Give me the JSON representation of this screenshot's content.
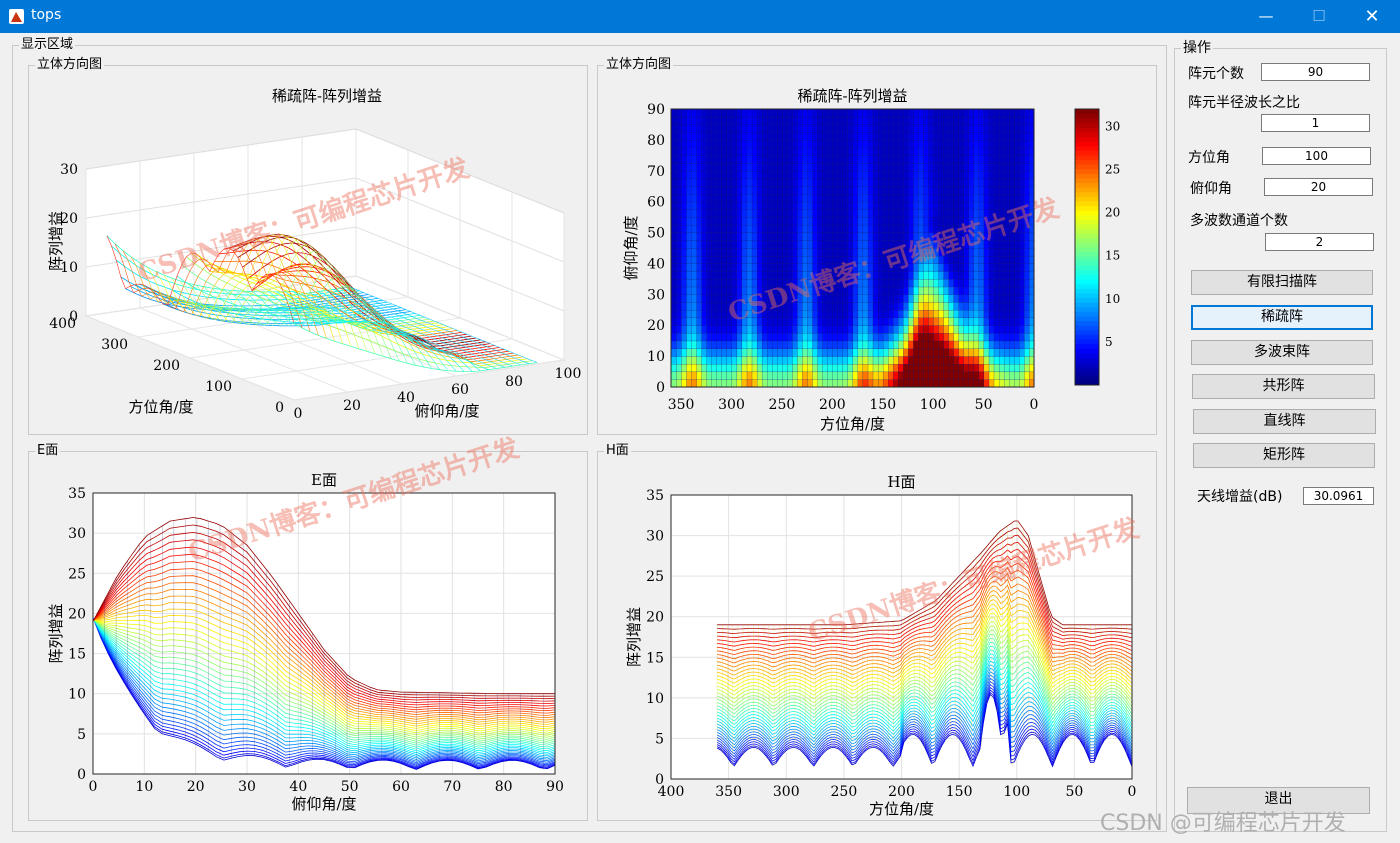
{
  "window": {
    "title": "tops",
    "minimize": "—",
    "maximize": "☐",
    "close": "✕"
  },
  "display_area": {
    "title": "显示区域"
  },
  "panels": {
    "p3d": {
      "title": "立体方向图"
    },
    "pheat": {
      "title": "立体方向图"
    },
    "pe": {
      "title": "E面"
    },
    "ph": {
      "title": "H面"
    }
  },
  "charts": {
    "surface3d": {
      "title": "稀疏阵-阵列增益",
      "xlabel": "俯仰角/度",
      "ylabel": "方位角/度",
      "zlabel": "阵列增益"
    },
    "heatmap": {
      "title": "稀疏阵-阵列增益",
      "xlabel": "方位角/度",
      "ylabel": "俯仰角/度"
    },
    "eplane": {
      "title": "E面",
      "xlabel": "俯仰角/度",
      "ylabel": "阵列增益"
    },
    "hplane": {
      "title": "H面",
      "xlabel": "方位角/度",
      "ylabel": "阵列增益"
    }
  },
  "chart_data": [
    {
      "type": "line",
      "id": "surface3d",
      "title": "稀疏阵-阵列增益",
      "xlabel": "俯仰角/度",
      "ylabel": "方位角/度",
      "zlabel": "阵列增益",
      "xticks": [
        0,
        20,
        40,
        60,
        80,
        100
      ],
      "yticks": [
        0,
        100,
        200,
        300,
        400
      ],
      "zticks": [
        0,
        10,
        20,
        30
      ],
      "xlim": [
        0,
        100
      ],
      "ylim": [
        0,
        400
      ],
      "zlim": [
        0,
        30
      ],
      "peak": 32,
      "grid": true,
      "colormap": "jet"
    },
    {
      "type": "heatmap",
      "id": "heatmap",
      "title": "稀疏阵-阵列增益",
      "xlabel": "方位角/度",
      "ylabel": "俯仰角/度",
      "xticks": [
        350,
        300,
        250,
        200,
        150,
        100,
        50,
        0
      ],
      "yticks": [
        0,
        10,
        20,
        30,
        40,
        50,
        60,
        70,
        80,
        90
      ],
      "xlim": [
        360,
        0
      ],
      "ylim": [
        0,
        90
      ],
      "colorbar_ticks": [
        5,
        10,
        15,
        20,
        25,
        30
      ],
      "colorbar_range": [
        0,
        32
      ],
      "colormap": "jet",
      "peak": {
        "azimuth": 100,
        "elevation": 20,
        "value": 32
      }
    },
    {
      "type": "line",
      "id": "eplane",
      "title": "E面",
      "xlabel": "俯仰角/度",
      "ylabel": "阵列增益",
      "xticks": [
        0,
        10,
        20,
        30,
        40,
        50,
        60,
        70,
        80,
        90
      ],
      "yticks": [
        0,
        5,
        10,
        15,
        20,
        25,
        30,
        35
      ],
      "xlim": [
        0,
        90
      ],
      "ylim": [
        0,
        35
      ],
      "grid": true,
      "peak_curve": [
        [
          0,
          19
        ],
        [
          5,
          25
        ],
        [
          10,
          29.5
        ],
        [
          15,
          31.5
        ],
        [
          20,
          32
        ],
        [
          25,
          31
        ],
        [
          30,
          28.5
        ],
        [
          35,
          24.5
        ],
        [
          40,
          20
        ],
        [
          45,
          15.5
        ],
        [
          50,
          12
        ],
        [
          55,
          10.5
        ],
        [
          60,
          10.2
        ],
        [
          70,
          10.1
        ],
        [
          80,
          10
        ],
        [
          90,
          10
        ]
      ]
    },
    {
      "type": "line",
      "id": "hplane",
      "title": "H面",
      "xlabel": "方位角/度",
      "ylabel": "阵列增益",
      "xticks": [
        400,
        350,
        300,
        250,
        200,
        150,
        100,
        50,
        0
      ],
      "yticks": [
        0,
        5,
        10,
        15,
        20,
        25,
        30,
        35
      ],
      "xlim": [
        400,
        0
      ],
      "ylim": [
        0,
        35
      ],
      "grid": true,
      "peak_curve": [
        [
          360,
          19
        ],
        [
          250,
          19
        ],
        [
          200,
          19.5
        ],
        [
          170,
          22
        ],
        [
          150,
          25
        ],
        [
          130,
          28
        ],
        [
          115,
          30.5
        ],
        [
          100,
          32
        ],
        [
          90,
          30
        ],
        [
          80,
          25
        ],
        [
          70,
          20
        ],
        [
          60,
          19
        ],
        [
          0,
          19
        ]
      ]
    }
  ],
  "controls": {
    "title": "操作",
    "element_count_label": "阵元个数",
    "element_count_value": "90",
    "radius_ratio_label": "阵元半径波长之比",
    "radius_ratio_value": "1",
    "azimuth_label": "方位角",
    "azimuth_value": "100",
    "elevation_label": "俯仰角",
    "elevation_value": "20",
    "beam_channels_label": "多波数通道个数",
    "beam_channels_value": "2",
    "btn_limited_scan": "有限扫描阵",
    "btn_sparse": "稀疏阵",
    "btn_multibeam": "多波束阵",
    "btn_conformal": "共形阵",
    "btn_linear": "直线阵",
    "btn_rect": "矩形阵",
    "gain_label": "天线增益(dB)",
    "gain_value": "30.0961",
    "exit": "退出"
  },
  "watermarks": {
    "a": "CSDN博客：可编程芯片开发",
    "b": "CSDN博客：可编程芯片开发",
    "c": "CSDN博客：可编程芯片开发",
    "d": "CSDN博客：可编程芯片开发",
    "footer": "CSDN @可编程芯片开发"
  }
}
